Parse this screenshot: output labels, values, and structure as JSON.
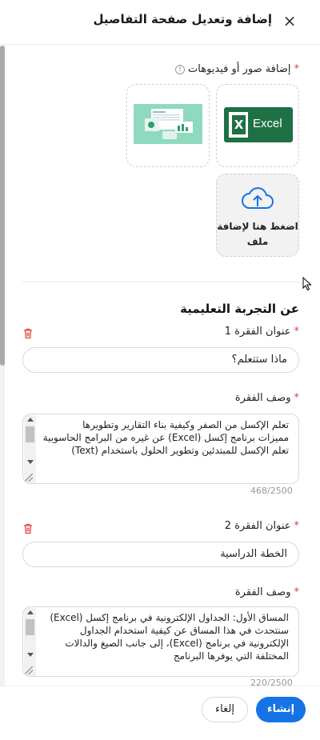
{
  "header": {
    "title": "إضافة وتعديل صفحة التفاصيل",
    "close_icon": "×"
  },
  "media": {
    "label": "إضافة صور أو فيديوهات",
    "info_icon": "!",
    "excel_label": "Excel",
    "upload_label": "اضغط هنا لإضافة ملف"
  },
  "learning": {
    "section_title": "عن التجربة التعليمية",
    "paragraphs": [
      {
        "title_label": "عنوان الفقرة 1",
        "title_value": "ماذا ستتعلم؟",
        "desc_label": "وصف الفقرة",
        "desc_value": "تعلم الإكسل من الصفر وكيفية بناء التقارير وتطويرها\nمميزات برنامج إكسل (Excel) عن غيره من البرامج الحاسوبية\nتعلم الإكسل للمبتدئين وتطوير الحلول باستخدام (Text)",
        "counter": "468/2500"
      },
      {
        "title_label": "عنوان الفقرة 2",
        "title_value": "الخطة الدراسية",
        "desc_label": "وصف الفقرة",
        "desc_value": "المساق الأول: الجداول الإلكترونية في برنامج إكسل (Excel)\nسنتحدث في هذا المساق عن كيفية استخدام الجداول الإلكترونية في برنامج (Excel)، إلى جانب الصيغ والدالات\nالمختلفة التي يوفرها البرنامج",
        "counter": "220/2500"
      }
    ]
  },
  "footer": {
    "create_label": "إنشاء",
    "cancel_label": "إلغاء"
  },
  "colors": {
    "primary": "#1573e5",
    "required": "#e0403a",
    "excel_green": "#1e7145"
  }
}
